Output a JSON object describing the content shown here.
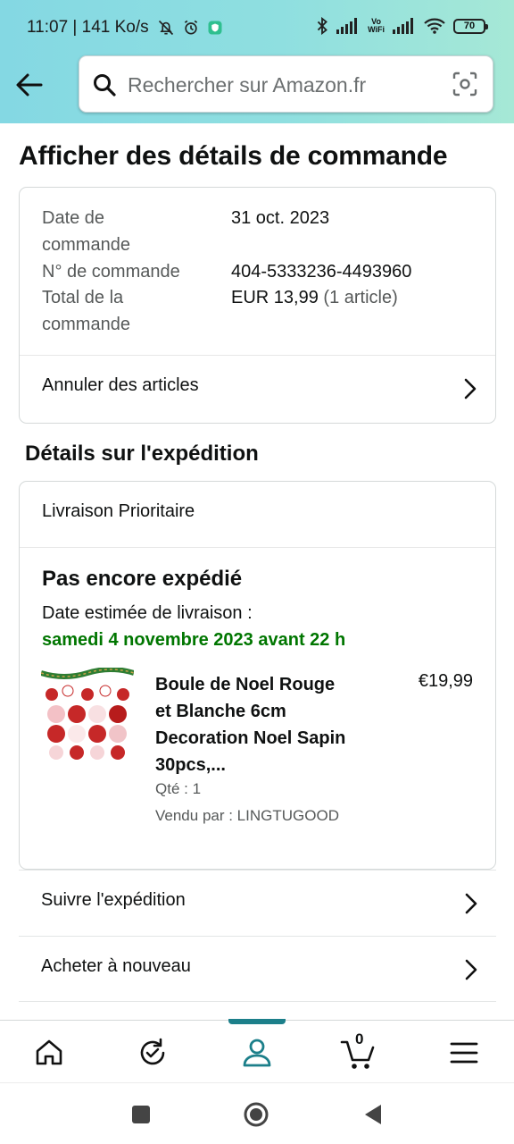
{
  "status_bar": {
    "time_speed": "11:07 | 141 Ko/s",
    "vo_wifi_top": "Vo",
    "vo_wifi_bottom": "WiFi",
    "battery": "70"
  },
  "header": {
    "search_placeholder": "Rechercher sur Amazon.fr"
  },
  "page_title": "Afficher des détails de commande",
  "order_summary": {
    "date_label_l1": "Date de",
    "date_label_l2": "commande",
    "date_value": "31 oct. 2023",
    "number_label": "N° de commande",
    "number_value": "404-5333236-4493960",
    "total_label_l1": "Total de la",
    "total_label_l2": "commande",
    "total_value": "EUR 13,99",
    "total_items": "(1 article)",
    "cancel_label": "Annuler des articles"
  },
  "shipment": {
    "section_title": "Détails sur l'expédition",
    "speed": "Livraison Prioritaire",
    "status": "Pas encore expédié",
    "estimate_label": "Date estimée de livraison :",
    "estimate_date": "samedi 4 novembre 2023 avant 22 h",
    "product": {
      "title_l1": "Boule de Noel Rouge",
      "title_l2": "et Blanche 6cm",
      "title_l3": "Decoration Noel Sapin",
      "title_l4": "30pcs,...",
      "price": "€19,99",
      "quantity": "Qté : 1",
      "seller": "Vendu par : LINGTUGOOD"
    }
  },
  "actions": {
    "track": "Suivre l'expédition",
    "buy_again": "Acheter à nouveau"
  },
  "bottom_nav": {
    "cart_count": "0",
    "active": "account"
  },
  "colors": {
    "header_gradient_start": "#84d8e3",
    "header_gradient_end": "#a6e8d6",
    "delivery_green": "#007600",
    "active_nav": "#1c7f8a"
  }
}
